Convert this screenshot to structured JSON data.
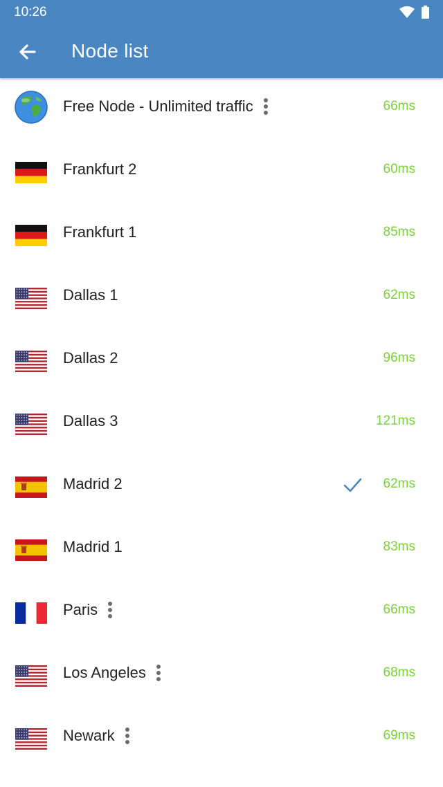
{
  "status": {
    "time": "10:26"
  },
  "header": {
    "title": "Node list"
  },
  "nodes": [
    {
      "name": "Free Node - Unlimited traffic",
      "ping": "66ms",
      "flag": "globe",
      "menu": true
    },
    {
      "name": "Frankfurt 2",
      "ping": "60ms",
      "flag": "de"
    },
    {
      "name": "Frankfurt 1",
      "ping": "85ms",
      "flag": "de"
    },
    {
      "name": "Dallas 1",
      "ping": "62ms",
      "flag": "us"
    },
    {
      "name": "Dallas 2",
      "ping": "96ms",
      "flag": "us"
    },
    {
      "name": "Dallas 3",
      "ping": "121ms",
      "flag": "us"
    },
    {
      "name": "Madrid 2",
      "ping": "62ms",
      "flag": "es",
      "selected": true
    },
    {
      "name": "Madrid 1",
      "ping": "83ms",
      "flag": "es"
    },
    {
      "name": "Paris",
      "ping": "66ms",
      "flag": "fr",
      "menu": true
    },
    {
      "name": "Los Angeles",
      "ping": "68ms",
      "flag": "us",
      "menu": true
    },
    {
      "name": "Newark",
      "ping": "69ms",
      "flag": "us",
      "menu": true
    }
  ],
  "colors": {
    "appbar": "#4a87c2",
    "ping": "#7bd23a",
    "check": "#4a87c2"
  }
}
